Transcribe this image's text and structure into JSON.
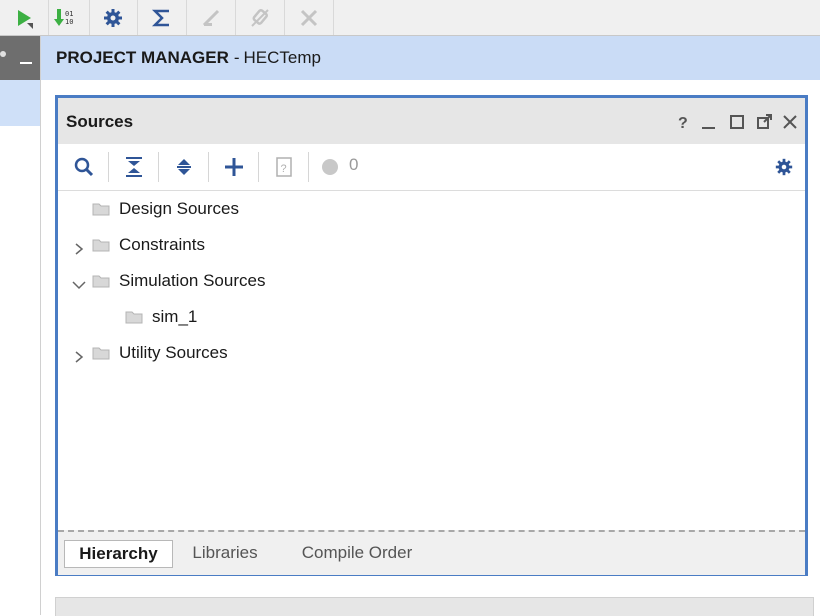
{
  "toolbar": {
    "items": [
      {
        "name": "run",
        "icon": "run-icon"
      },
      {
        "name": "program",
        "icon": "program-device-icon"
      },
      {
        "name": "settings",
        "icon": "gear-icon"
      },
      {
        "name": "sigma",
        "icon": "sigma-icon"
      },
      {
        "name": "disabled1",
        "icon": "disabled-tool-icon"
      },
      {
        "name": "disabled2",
        "icon": "disabled-tool-icon"
      },
      {
        "name": "disabled3",
        "icon": "disabled-tool-icon"
      }
    ]
  },
  "header": {
    "title": "PROJECT MANAGER",
    "separator": "-",
    "project": "HECTemp"
  },
  "panel": {
    "title": "Sources",
    "window_controls": [
      "help-icon",
      "minimize-icon",
      "maximize-icon",
      "float-icon",
      "close-icon"
    ],
    "toolbar": {
      "badge_count": "0"
    },
    "tree": [
      {
        "label": "Design Sources",
        "expander": "none",
        "level": 0
      },
      {
        "label": "Constraints",
        "expander": "collapsed",
        "level": 0
      },
      {
        "label": "Simulation Sources",
        "expander": "expanded",
        "level": 0
      },
      {
        "label": "sim_1",
        "expander": "none",
        "level": 1
      },
      {
        "label": "Utility Sources",
        "expander": "collapsed",
        "level": 0
      }
    ],
    "tabs": [
      {
        "label": "Hierarchy",
        "active": true
      },
      {
        "label": "Libraries",
        "active": false
      },
      {
        "label": "Compile Order",
        "active": false
      }
    ]
  },
  "colors": {
    "accent_border": "#4a7cc4",
    "header_bg": "#cadcf6",
    "icon_blue": "#2f5597",
    "run_green": "#3cb043"
  }
}
